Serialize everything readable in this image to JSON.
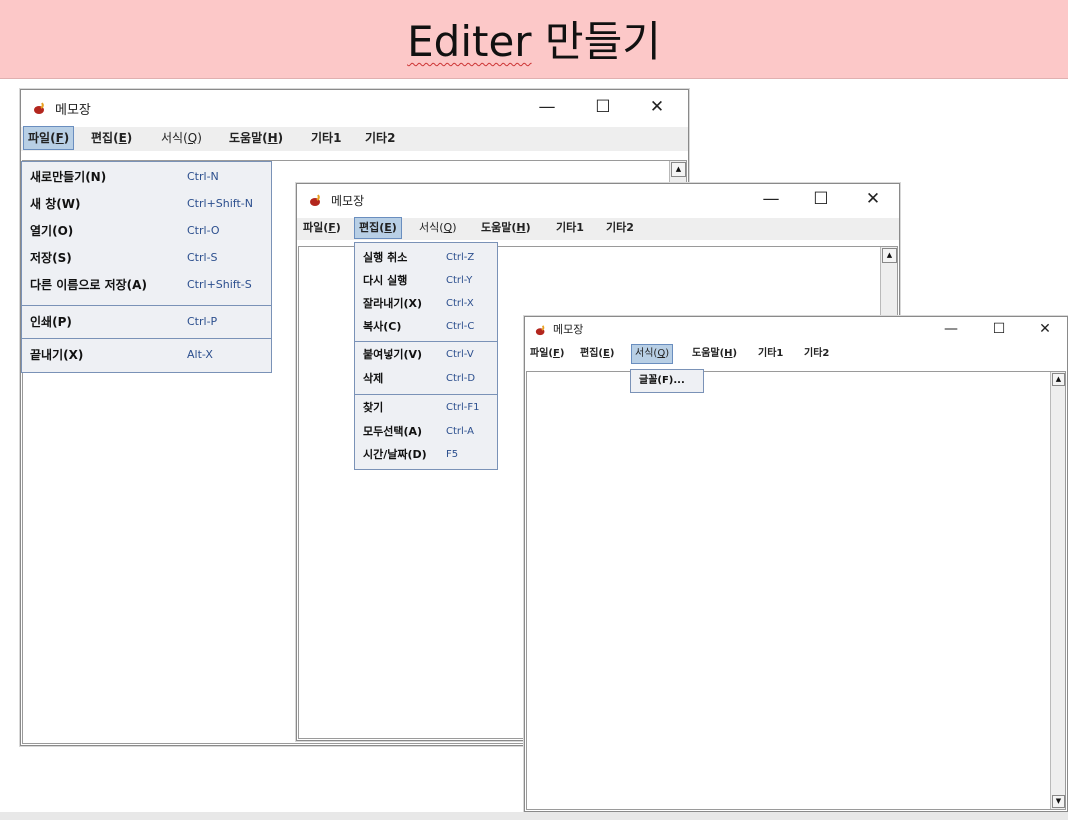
{
  "slide": {
    "title_part1": "Editer",
    "title_part2": " 만들기"
  },
  "windows": [
    {
      "title": "메모장",
      "controls": {
        "minimize": "—",
        "maximize": "☐",
        "close": "✕"
      },
      "menus": [
        "파일(F)",
        "편집(E)",
        "서식(Q)",
        "도움말(H)",
        "기타1",
        "기타2"
      ],
      "menu_parts": [
        {
          "pre": "파일(",
          "key": "F",
          "post": ")"
        },
        {
          "pre": "편집(",
          "key": "E",
          "post": ")"
        },
        {
          "pre": "서식(",
          "key": "Q",
          "post": ")"
        },
        {
          "pre": "도움말(",
          "key": "H",
          "post": ")"
        },
        {
          "pre": "기타1",
          "key": "",
          "post": ""
        },
        {
          "pre": "기타2",
          "key": "",
          "post": ""
        }
      ],
      "open_menu": "파일(F)",
      "popup": [
        {
          "label": "새로만들기(N)",
          "accel": "Ctrl-N"
        },
        {
          "label": "새 창(W)",
          "accel": "Ctrl+Shift-N"
        },
        {
          "label": "열기(O)",
          "accel": "Ctrl-O"
        },
        {
          "label": "저장(S)",
          "accel": "Ctrl-S"
        },
        {
          "label": "다른 이름으로 저장(A)",
          "accel": "Ctrl+Shift-S"
        },
        {
          "label": "인쇄(P)",
          "accel": "Ctrl-P"
        },
        {
          "label": "끝내기(X)",
          "accel": "Alt-X"
        }
      ]
    },
    {
      "title": "메모장",
      "controls": {
        "minimize": "—",
        "maximize": "☐",
        "close": "✕"
      },
      "open_menu": "편집(E)",
      "popup": [
        {
          "label": "실행 취소",
          "accel": "Ctrl-Z"
        },
        {
          "label": "다시 실행",
          "accel": "Ctrl-Y"
        },
        {
          "label": "잘라내기(X)",
          "accel": "Ctrl-X"
        },
        {
          "label": "복사(C)",
          "accel": "Ctrl-C"
        },
        {
          "label": "붙여넣기(V)",
          "accel": "Ctrl-V"
        },
        {
          "label": "삭제",
          "accel": "Ctrl-D"
        },
        {
          "label": "찾기",
          "accel": "Ctrl-F1"
        },
        {
          "label": "모두선택(A)",
          "accel": "Ctrl-A"
        },
        {
          "label": "시간/날짜(D)",
          "accel": "F5"
        }
      ]
    },
    {
      "title": "메모장",
      "controls": {
        "minimize": "—",
        "maximize": "☐",
        "close": "✕"
      },
      "open_menu": "서식(Q)",
      "popup": [
        {
          "label": "글꼴(F)...",
          "accel": ""
        }
      ]
    }
  ],
  "scroll_arrows": {
    "up": "▲",
    "down": "▼"
  },
  "colors": {
    "banner": "#fcc8c8",
    "menu_highlight": "#b8cfe5",
    "accelerator": "#2c4f8e"
  }
}
